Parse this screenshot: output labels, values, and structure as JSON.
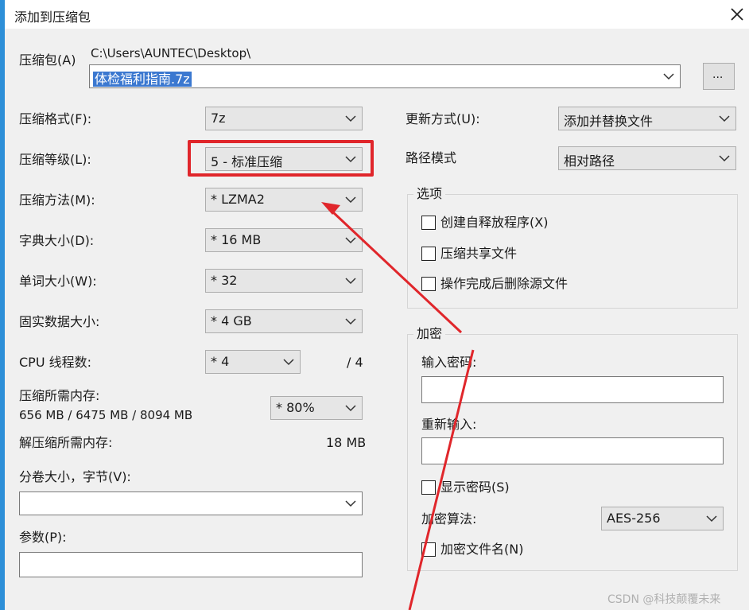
{
  "window": {
    "title": "添加到压缩包"
  },
  "archive": {
    "label": "压缩包(A)",
    "path": "C:\\Users\\AUNTEC\\Desktop\\",
    "filename": "体检福利指南.7z",
    "browse_label": "..."
  },
  "left": {
    "format": {
      "label": "压缩格式(F):",
      "value": "7z"
    },
    "level": {
      "label": "压缩等级(L):",
      "value": "5 - 标准压缩"
    },
    "method": {
      "label": "压缩方法(M):",
      "value": "* LZMA2"
    },
    "dict": {
      "label": "字典大小(D):",
      "value": "* 16 MB"
    },
    "word": {
      "label": "单词大小(W):",
      "value": "* 32"
    },
    "solid": {
      "label": "固实数据大小:",
      "value": "* 4 GB"
    },
    "threads": {
      "label": "CPU 线程数:",
      "value": "* 4",
      "max": "/ 4"
    },
    "mem_compress": {
      "label": "压缩所需内存:",
      "detail": "656 MB / 6475 MB / 8094 MB",
      "value": "* 80%"
    },
    "mem_decompress": {
      "label": "解压缩所需内存:",
      "value": "18 MB"
    },
    "volume": {
      "label": "分卷大小，字节(V):",
      "value": ""
    },
    "params": {
      "label": "参数(P):",
      "value": ""
    }
  },
  "right": {
    "update": {
      "label": "更新方式(U):",
      "value": "添加并替换文件"
    },
    "path_mode": {
      "label": "路径模式",
      "value": "相对路径"
    },
    "options": {
      "title": "选项",
      "items": [
        {
          "label": "创建自释放程序(X)",
          "checked": false
        },
        {
          "label": "压缩共享文件",
          "checked": false
        },
        {
          "label": "操作完成后删除源文件",
          "checked": false
        }
      ]
    },
    "encryption": {
      "title": "加密",
      "password_label": "输入密码:",
      "reenter_label": "重新输入:",
      "show_password": "显示密码(S)",
      "method_label": "加密算法:",
      "method_value": "AES-256",
      "encrypt_names": "加密文件名(N)"
    }
  },
  "annotation_color": "#e0262b",
  "watermark": "CSDN @科技颠覆未来"
}
